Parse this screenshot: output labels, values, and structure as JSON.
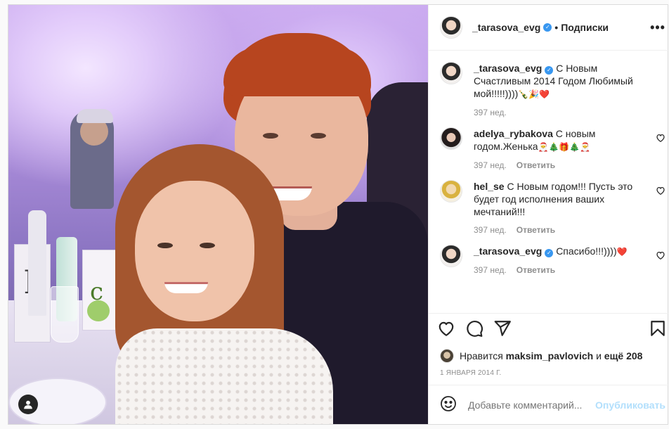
{
  "post": {
    "author": "_tarasova_evg",
    "follow_label": "Подписки",
    "more_label": "•••",
    "photo_alt": "Фото"
  },
  "comments": [
    {
      "user": "_tarasova_evg",
      "text": "С Новым Счастливым 2014 Годом Любимый мой!!!!!))))",
      "emoji": "🍾🎉❤️",
      "time": "397 нед.",
      "reply": "",
      "avatar": "av-t",
      "verified": true,
      "liked_icon": false
    },
    {
      "user": "adelya_rybakova",
      "text": "С новым годом.Женька",
      "emoji": "🎅🎄🎁🎄🎅",
      "time": "397 нед.",
      "reply": "Ответить",
      "avatar": "av-a",
      "verified": false,
      "liked_icon": true
    },
    {
      "user": "hel_se",
      "text": "С Новым годом!!! Пусть это будет год исполнения ваших мечтаний!!!",
      "emoji": "",
      "time": "397 нед.",
      "reply": "Ответить",
      "avatar": "av-h",
      "verified": false,
      "liked_icon": true
    },
    {
      "user": "_tarasova_evg",
      "text": "Спасибо!!!))))",
      "emoji": "❤️",
      "time": "397 нед.",
      "reply": "Ответить",
      "avatar": "av-t",
      "verified": true,
      "liked_icon": true
    }
  ],
  "likes": {
    "prefix": "Нравится",
    "user": "maksim_pavlovich",
    "conj": "и",
    "rest": "ещё 208"
  },
  "date": "1 ЯНВАРЯ 2014 Г.",
  "add_comment": {
    "placeholder": "Добавьте комментарий...",
    "publish": "Опубликовать"
  },
  "icons": {
    "like": "heart-icon",
    "comment": "comment-icon",
    "share": "share-icon",
    "save": "bookmark-icon",
    "emoji": "emoji-icon",
    "user_tag": "user-icon"
  },
  "colors": {
    "verified": "#3897f0",
    "publish_disabled": "#b2dffc",
    "secondary_text": "#8e8e8e"
  }
}
